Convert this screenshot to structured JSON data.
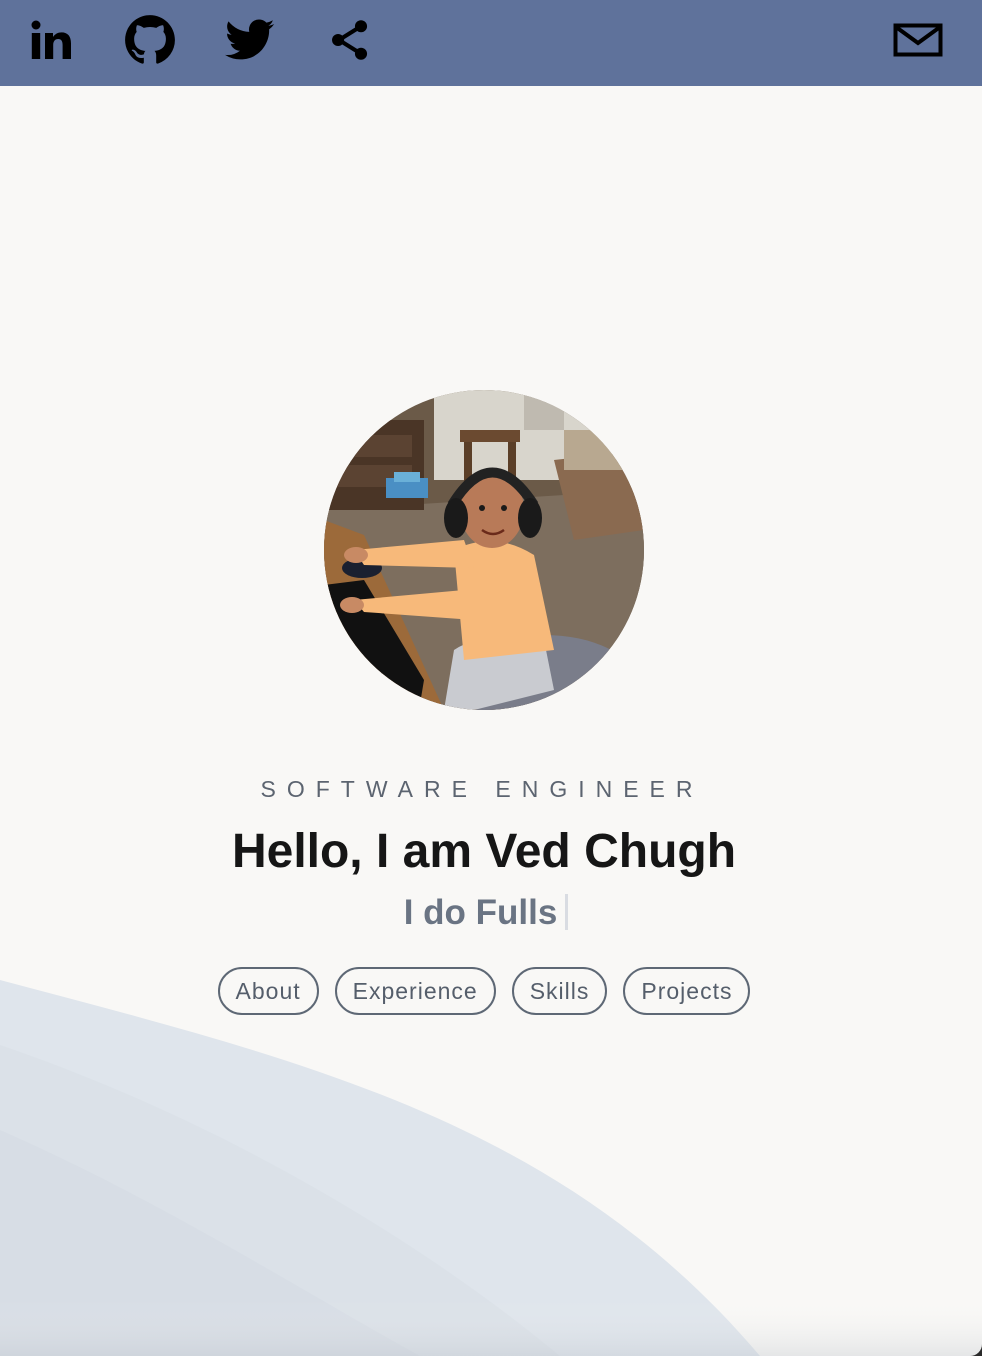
{
  "header": {
    "background_color": "#5f729b",
    "icons": [
      "linkedin-icon",
      "github-icon",
      "twitter-icon",
      "share-icon",
      "mail-icon"
    ]
  },
  "hero": {
    "subtitle": "SOFTWARE ENGINEER",
    "title": "Hello, I am Ved Chugh",
    "typed_text": "I do Fulls"
  },
  "nav": {
    "buttons": [
      {
        "label": "About"
      },
      {
        "label": "Experience"
      },
      {
        "label": "Skills"
      },
      {
        "label": "Projects"
      }
    ]
  },
  "colors": {
    "background": "#f9f8f6",
    "wave": "#dfe5ec",
    "text_dark": "#161616",
    "text_muted": "#6a7483"
  }
}
